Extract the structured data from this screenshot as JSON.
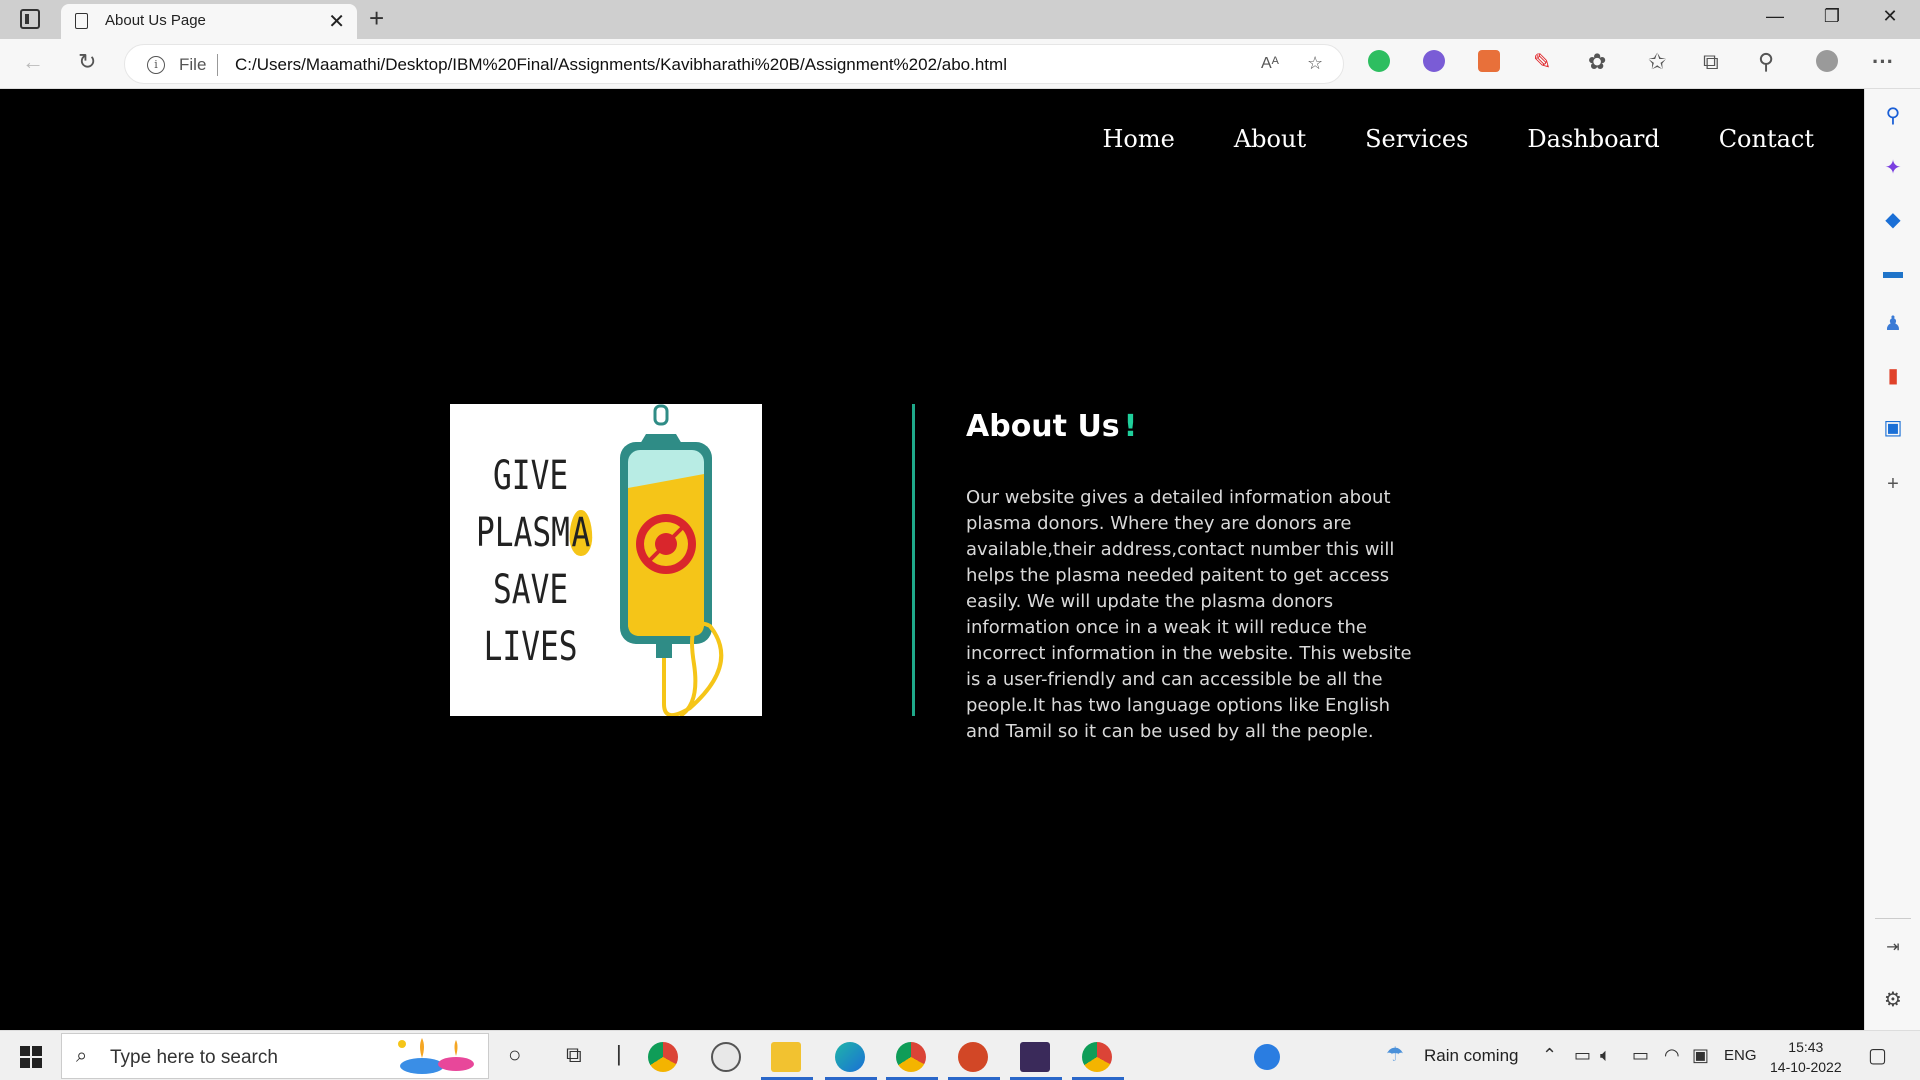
{
  "browser": {
    "tab_title": "About Us Page",
    "tab_close": "✕",
    "new_tab": "+",
    "window_controls": {
      "minimize": "—",
      "restore": "❐",
      "close": "✕"
    },
    "address": {
      "scheme_label": "File",
      "url": "C:/Users/Maamathi/Desktop/IBM%20Final/Assignments/Kavibharathi%20B/Assignment%202/abo.html"
    },
    "more_label": "···"
  },
  "nav": {
    "items": [
      {
        "label": "Home"
      },
      {
        "label": "About"
      },
      {
        "label": "Services"
      },
      {
        "label": "Dashboard"
      },
      {
        "label": "Contact"
      }
    ]
  },
  "hero_image": {
    "lines": [
      "GIVE",
      "PLASM",
      "SAVE",
      "LIVES"
    ],
    "highlight_letter": "A"
  },
  "about": {
    "title": "About Us",
    "exclamation": "!",
    "body": "Our website gives a detailed information about plasma donors. Where they are donors are available,their address,contact number this will helps the plasma needed paitent to get access easily. We will update the plasma donors information once in a weak it will reduce the incorrect information in the website. This website is a user-friendly and can accessible be all the people.It has two language options like English and Tamil so it can be used by all the people."
  },
  "taskbar": {
    "search_placeholder": "Type here to search",
    "weather": "Rain coming",
    "language": "ENG",
    "time": "15:43",
    "date": "14-10-2022"
  },
  "colors": {
    "accent": "#1fcf9b",
    "divider": "#1fa98a",
    "page_bg": "#000000"
  }
}
